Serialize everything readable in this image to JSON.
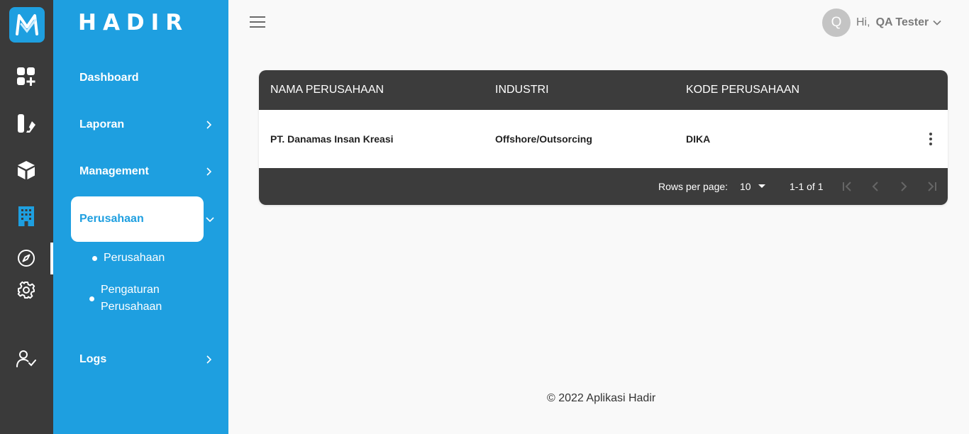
{
  "app": {
    "brand": "HADIR"
  },
  "rail": {
    "icons": [
      "app-logo-icon",
      "dashboard-icon",
      "report-icon",
      "box-icon",
      "building-icon",
      "compass-icon",
      "gear-icon",
      "user-check-icon"
    ],
    "accent_color": "#1e9fe0",
    "background_color": "#3a3a3a"
  },
  "sidebar": {
    "items": [
      {
        "label": "Dashboard"
      },
      {
        "label": "Laporan"
      },
      {
        "label": "Management"
      },
      {
        "label": "Perusahaan"
      },
      {
        "label": "Logs"
      }
    ],
    "subitems": [
      {
        "label": "Perusahaan"
      },
      {
        "label_line1": "Pengaturan",
        "label_line2": "Perusahaan"
      }
    ],
    "background_color": "#1e9fe0"
  },
  "header": {
    "avatar_initial": "Q",
    "greeting": "Hi,",
    "user_name": "QA Tester"
  },
  "table": {
    "columns": [
      "NAMA PERUSAHAAN",
      "INDUSTRI",
      "KODE PERUSAHAAN"
    ],
    "rows": [
      {
        "nama": "PT. Danamas Insan Kreasi",
        "industri": "Offshore/Outsorcing",
        "kode": "DIKA"
      }
    ],
    "rows_per_page_label": "Rows per page:",
    "rows_per_page_value": "10",
    "range_label": "1-1 of 1",
    "header_color": "#3c3c3c"
  },
  "footer": {
    "text": "© 2022 Aplikasi Hadir"
  }
}
